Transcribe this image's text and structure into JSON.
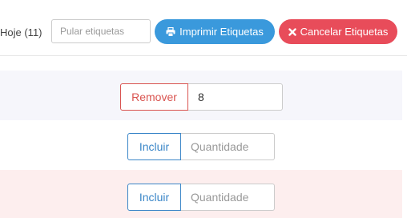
{
  "toolbar": {
    "today_label": "Hoje (11)",
    "skip_placeholder": "Pular etiquetas",
    "print_label": "Imprimir Etiquetas",
    "cancel_label": "Cancelar Etiquetas",
    "print_icon": "printer-icon",
    "cancel_icon": "close-icon",
    "colors": {
      "print": "#3a99dc",
      "cancel": "#e84c5a"
    }
  },
  "rows": [
    {
      "action_label": "Remover",
      "quantity_value": "8",
      "quantity_placeholder": "Quantidade",
      "background": "#f6f6fb"
    },
    {
      "action_label": "Incluir",
      "quantity_value": "",
      "quantity_placeholder": "Quantidade",
      "background": "#ffffff"
    },
    {
      "action_label": "Incluir",
      "quantity_value": "",
      "quantity_placeholder": "Quantidade",
      "background": "#fdeeee"
    }
  ]
}
